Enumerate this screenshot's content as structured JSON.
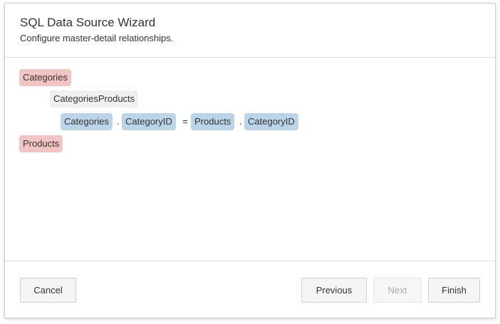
{
  "dialog": {
    "title": "SQL Data Source Wizard",
    "subtitle": "Configure master-detail relationships."
  },
  "tree": {
    "master_table": "Categories",
    "relation_name": "CategoriesProducts",
    "condition": {
      "left_table": "Categories",
      "left_dot": ".",
      "left_column": "CategoryID",
      "operator": "=",
      "right_table": "Products",
      "right_dot": ".",
      "right_column": "CategoryID"
    },
    "detail_table": "Products"
  },
  "footer": {
    "cancel_label": "Cancel",
    "previous_label": "Previous",
    "next_label": "Next",
    "finish_label": "Finish"
  },
  "colors": {
    "table_chip": "#f2c4c4",
    "relation_chip": "#f0f0f0",
    "column_chip": "#bcd4ea",
    "disabled_text": "#a8a8a8"
  }
}
